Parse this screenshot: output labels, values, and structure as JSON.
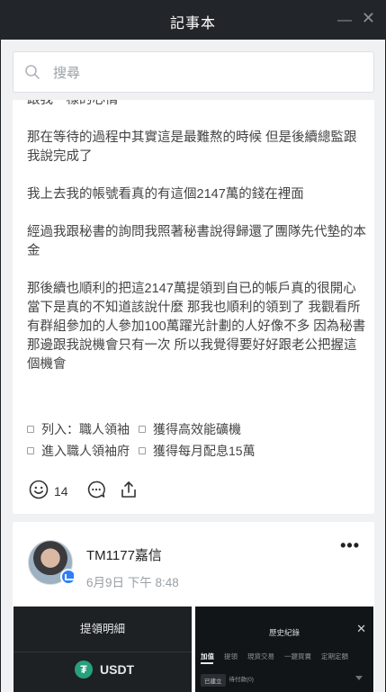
{
  "window": {
    "title": "記事本",
    "minimize_glyph": "—",
    "close_glyph": "✕"
  },
  "search": {
    "placeholder": "搜尋",
    "value": ""
  },
  "post1": {
    "paragraphs": [
      "跟我一樣的心情",
      "那在等待的過程中其實這是最難熬的時候 但是後續總監跟我說完成了",
      "我上去我的帳號看真的有這個2147萬的錢在裡面",
      "經過我跟秘書的詢問我照著秘書說得歸還了團隊先代墊的本金",
      "那後續也順利的把這2147萬提領到自已的帳戶真的很開心 當下是真的不知道該說什麼 那我也順利的領到了 我觀看所有群組參加的人參加100萬躍光計劃的人好像不多 因為秘書那邊跟我說機會只有一次 所以我覺得要好好跟老公把握這個機會"
    ],
    "tags": [
      [
        "列入：職人領袖",
        "獲得高效能礦機"
      ],
      [
        "進入職人領袖府",
        "獲得每月配息15萬"
      ]
    ],
    "reaction_count": "14"
  },
  "post2": {
    "author": "TM1177嘉信",
    "date": "6月9日 下午 8:48",
    "more_glyph": "•••",
    "shot_left": {
      "header": "提領明細",
      "coin_glyph": "₮",
      "coin_label": "USDT"
    },
    "shot_right": {
      "header": "歷史紀錄",
      "close_glyph": "✕",
      "tabs": [
        "加值",
        "提領",
        "現貨交易",
        "一鍵買賣",
        "定期定額"
      ],
      "filters": [
        "已建立",
        "待付款(0)"
      ]
    }
  },
  "colors": {
    "titlebar": "#22262a",
    "background": "#f0f1f2",
    "card": "#ffffff",
    "verified_badge": "#2d7ff9",
    "usdt": "#26a17b"
  },
  "icons": [
    "search-icon",
    "smile-icon",
    "comment-icon",
    "share-icon",
    "more-icon",
    "verified-badge-icon"
  ]
}
